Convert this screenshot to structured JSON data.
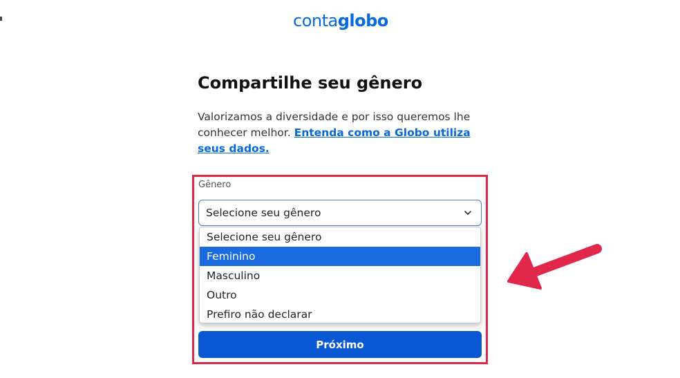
{
  "logo": {
    "part1": "conta",
    "part2": "globo"
  },
  "title": "Compartilhe seu gênero",
  "description": {
    "text": "Valorizamos a diversidade e por isso queremos lhe conhecer melhor.",
    "link": "Entenda como a Globo utiliza seus dados."
  },
  "field": {
    "label": "Gênero",
    "selected_value": "Selecione seu gênero"
  },
  "dropdown": {
    "options": [
      "Selecione seu gênero",
      "Feminino",
      "Masculino",
      "Outro",
      "Prefiro não declarar"
    ],
    "highlighted": "Feminino"
  },
  "next_button": "Próximo",
  "colors": {
    "brand_blue": "#0669de",
    "button_blue": "#0a57d4",
    "highlight_red": "#e0284a",
    "arrow_red": "#e0284a"
  }
}
